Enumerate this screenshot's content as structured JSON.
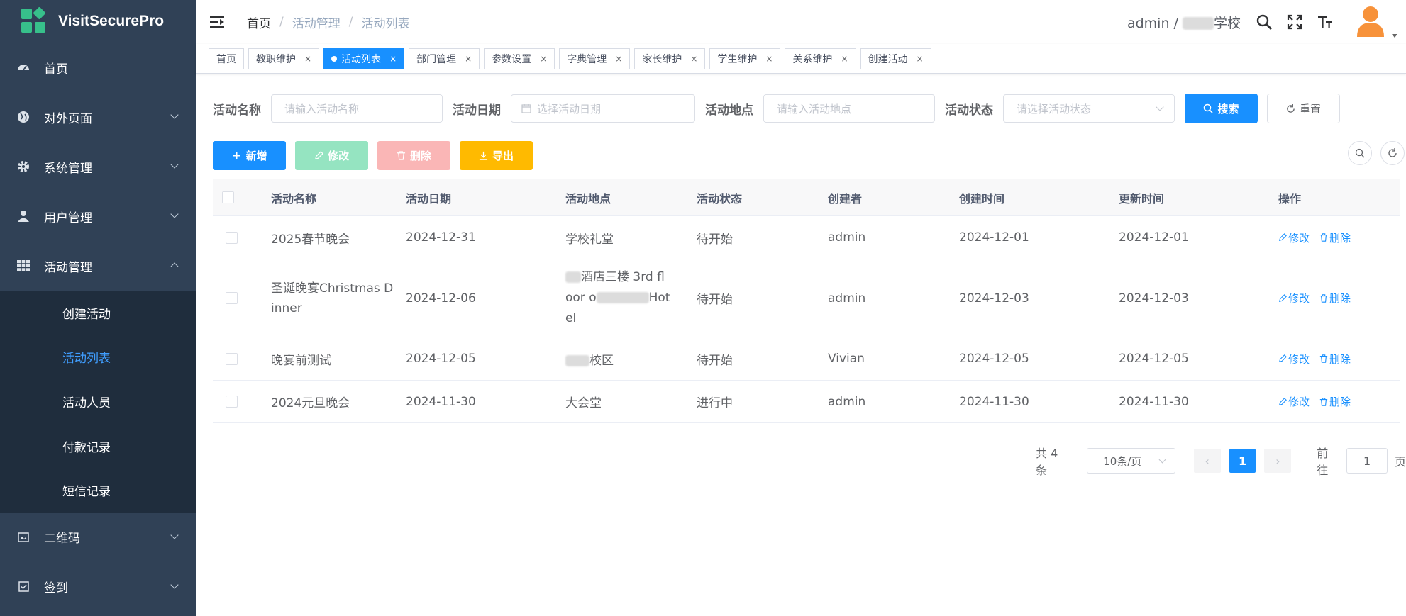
{
  "app": {
    "title": "VisitSecurePro"
  },
  "sidebar": {
    "items": [
      {
        "label": "首页",
        "icon": "dashboard-icon"
      },
      {
        "label": "对外页面",
        "icon": "globe-icon"
      },
      {
        "label": "系统管理",
        "icon": "gear-icon"
      },
      {
        "label": "用户管理",
        "icon": "user-icon"
      },
      {
        "label": "活动管理",
        "icon": "table-icon"
      }
    ],
    "submenu": [
      "创建活动",
      "活动列表",
      "活动人员",
      "付款记录",
      "短信记录"
    ],
    "bottom_items": [
      {
        "label": "二维码",
        "icon": "qrcode-icon"
      },
      {
        "label": "签到",
        "icon": "checkbox-icon"
      }
    ]
  },
  "header": {
    "breadcrumb": [
      "首页",
      "活动管理",
      "活动列表"
    ],
    "user_prefix": "admin /",
    "school_suffix": "学校"
  },
  "tags": [
    {
      "label": "首页",
      "active": false,
      "closable": false
    },
    {
      "label": "教职维护",
      "active": false,
      "closable": true
    },
    {
      "label": "活动列表",
      "active": true,
      "closable": true
    },
    {
      "label": "部门管理",
      "active": false,
      "closable": true
    },
    {
      "label": "参数设置",
      "active": false,
      "closable": true
    },
    {
      "label": "字典管理",
      "active": false,
      "closable": true
    },
    {
      "label": "家长维护",
      "active": false,
      "closable": true
    },
    {
      "label": "学生维护",
      "active": false,
      "closable": true
    },
    {
      "label": "关系维护",
      "active": false,
      "closable": true
    },
    {
      "label": "创建活动",
      "active": false,
      "closable": true
    }
  ],
  "tag_close": "×",
  "search": {
    "name_label": "活动名称",
    "name_placeholder": "请输入活动名称",
    "date_label": "活动日期",
    "date_placeholder": "选择活动日期",
    "place_label": "活动地点",
    "place_placeholder": "请输入活动地点",
    "status_label": "活动状态",
    "status_placeholder": "请选择活动状态",
    "search_btn": "搜索",
    "reset_btn": "重置"
  },
  "toolbar": {
    "add": "新增",
    "edit": "修改",
    "delete": "删除",
    "export": "导出"
  },
  "colors": {
    "primary": "#1890ff",
    "edit_disabled": "#95e4c1",
    "delete_disabled": "#fab6b6",
    "export": "#ffba00",
    "sidebar": "#304156",
    "submenu": "#1f2d3d"
  },
  "table": {
    "headers": [
      "活动名称",
      "活动日期",
      "活动地点",
      "活动状态",
      "创建者",
      "创建时间",
      "更新时间",
      "操作"
    ],
    "rows": [
      {
        "name": "2025春节晚会",
        "date": "2024-12-31",
        "place": "学校礼堂",
        "status": "待开始",
        "creator": "admin",
        "created": "2024-12-01",
        "updated": "2024-12-01"
      },
      {
        "name": "圣诞晚宴Christmas Dinner",
        "date": "2024-12-06",
        "place": "酒店三楼 3rd floor o Hotel",
        "place_parts": [
          "酒店三楼 3rd fl",
          "oor o",
          "Hot",
          "el"
        ],
        "status": "待开始",
        "creator": "admin",
        "created": "2024-12-03",
        "updated": "2024-12-03"
      },
      {
        "name": "晚宴前测试",
        "date": "2024-12-05",
        "place": "校区",
        "status": "待开始",
        "creator": "Vivian",
        "created": "2024-12-05",
        "updated": "2024-12-05"
      },
      {
        "name": "2024元旦晚会",
        "date": "2024-11-30",
        "place": "大会堂",
        "status": "进行中",
        "creator": "admin",
        "created": "2024-11-30",
        "updated": "2024-11-30"
      }
    ],
    "op_edit": "修改",
    "op_delete": "删除"
  },
  "pagination": {
    "total_text": "共 4 条",
    "page_size": "10条/页",
    "current_page": "1",
    "goto_label": "前往",
    "goto_value": "1",
    "page_suffix": "页"
  }
}
